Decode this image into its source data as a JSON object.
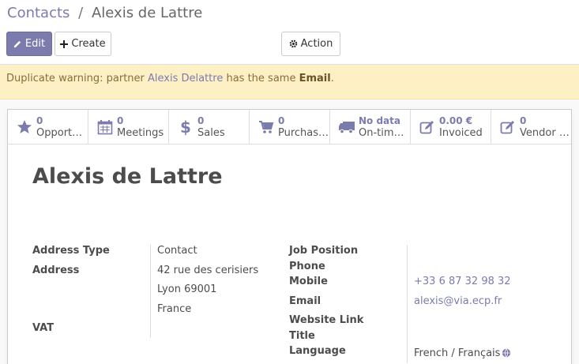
{
  "breadcrumb": {
    "parent": "Contacts",
    "separator": "/",
    "current": "Alexis de Lattre"
  },
  "toolbar": {
    "edit_label": "Edit",
    "create_label": "Create",
    "action_label": "Action"
  },
  "warning": {
    "prefix": "Duplicate warning: partner ",
    "partner": "Alexis Delattre",
    "middle": " has the same ",
    "field": "Email",
    "suffix": "."
  },
  "stats": [
    {
      "icon": "star-icon",
      "value": "0",
      "label": "Opportunities"
    },
    {
      "icon": "calendar-icon",
      "value": "0",
      "label": "Meetings"
    },
    {
      "icon": "dollar-icon",
      "value": "0",
      "label": "Sales"
    },
    {
      "icon": "cart-icon",
      "value": "0",
      "label": "Purchases"
    },
    {
      "icon": "truck-icon",
      "value": "No data",
      "label": "On-time Rate"
    },
    {
      "icon": "invoice-icon",
      "value": "0.00 €",
      "label": "Invoiced"
    },
    {
      "icon": "vendor-bill-icon",
      "value": "0",
      "label": "Vendor Bills"
    }
  ],
  "partner": {
    "name": "Alexis de Lattre"
  },
  "labels": {
    "address_type": "Address Type",
    "address": "Address",
    "vat": "VAT",
    "job_position": "Job Position",
    "phone": "Phone",
    "mobile": "Mobile",
    "email": "Email",
    "website": "Website Link",
    "title": "Title",
    "language": "Language"
  },
  "values": {
    "address_type": "Contact",
    "street": "42 rue des cerisiers",
    "city": "Lyon 69001",
    "country": "France",
    "mobile": "+33 6 87 32 98 32",
    "email": "alexis@via.ecp.fr",
    "language": "French / Français"
  },
  "colors": {
    "accent": "#7c7bad",
    "warning_bg": "#fcf0c4",
    "warning_text": "#8a6d3b"
  }
}
